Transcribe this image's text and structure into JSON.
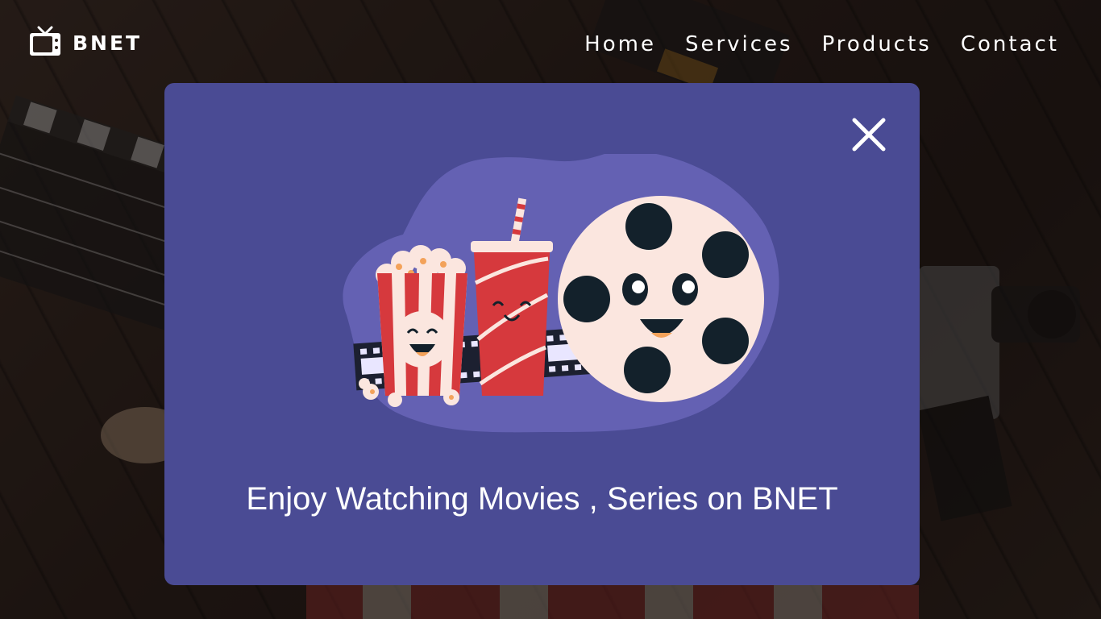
{
  "brand": {
    "name": "BNET",
    "icon": "tv-icon"
  },
  "nav": {
    "items": [
      {
        "label": "Home"
      },
      {
        "label": "Services"
      },
      {
        "label": "Products"
      },
      {
        "label": "Contact"
      }
    ]
  },
  "modal": {
    "title": "Enjoy Watching Movies , Series on BNET",
    "close_icon": "close-icon",
    "illustration": "popcorn-soda-film-reel-illustration"
  },
  "colors": {
    "modal_bg": "#4a4b94",
    "blob": "#6461b3",
    "popcorn_red": "#d6393d",
    "reel_face": "#fbe6df",
    "reel_holes": "#13212b"
  }
}
